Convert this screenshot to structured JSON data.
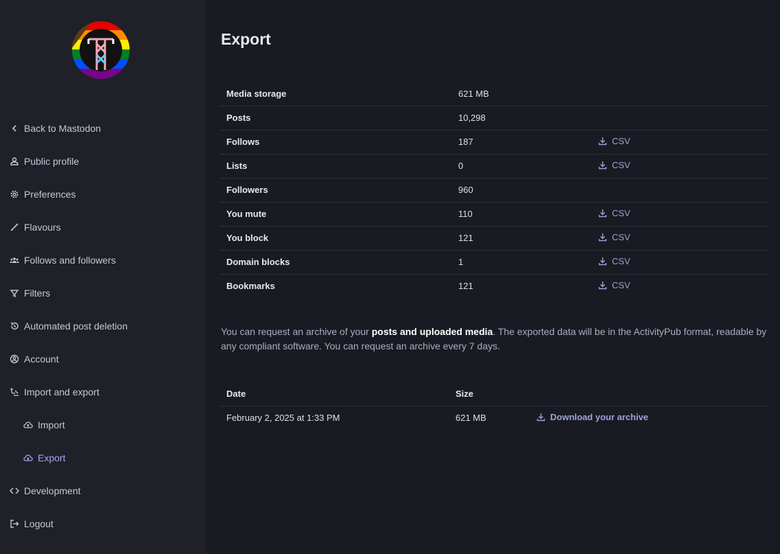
{
  "sidebar": {
    "nav": [
      {
        "label": "Back to Mastodon",
        "icon": "chevron-left-icon"
      },
      {
        "label": "Public profile",
        "icon": "person-icon"
      },
      {
        "label": "Preferences",
        "icon": "gear-icon"
      },
      {
        "label": "Flavours",
        "icon": "brush-icon"
      },
      {
        "label": "Follows and followers",
        "icon": "group-icon"
      },
      {
        "label": "Filters",
        "icon": "filter-icon"
      },
      {
        "label": "Automated post deletion",
        "icon": "history-icon"
      },
      {
        "label": "Account",
        "icon": "account-circle-icon"
      },
      {
        "label": "Import and export",
        "icon": "sync-alt-icon"
      },
      {
        "label": "Import",
        "icon": "cloud-upload-icon"
      },
      {
        "label": "Export",
        "icon": "cloud-download-icon"
      },
      {
        "label": "Development",
        "icon": "code-icon"
      },
      {
        "label": "Logout",
        "icon": "logout-icon"
      }
    ],
    "active_color": "#a8a3f5"
  },
  "main": {
    "title": "Export",
    "stats": [
      {
        "label": "Media storage",
        "value": "621 MB",
        "csv": ""
      },
      {
        "label": "Posts",
        "value": "10,298",
        "csv": ""
      },
      {
        "label": "Follows",
        "value": "187",
        "csv": "CSV"
      },
      {
        "label": "Lists",
        "value": "0",
        "csv": "CSV"
      },
      {
        "label": "Followers",
        "value": "960",
        "csv": ""
      },
      {
        "label": "You mute",
        "value": "110",
        "csv": "CSV"
      },
      {
        "label": "You block",
        "value": "121",
        "csv": "CSV"
      },
      {
        "label": "Domain blocks",
        "value": "1",
        "csv": "CSV"
      },
      {
        "label": "Bookmarks",
        "value": "121",
        "csv": "CSV"
      }
    ],
    "archive_text": {
      "before": "You can request an archive of your ",
      "strong": "posts and uploaded media",
      "after": ". The exported data will be in the ActivityPub format, readable by any compliant software. You can request an archive every 7 days."
    },
    "archives": {
      "headers": {
        "date": "Date",
        "size": "Size"
      },
      "rows": [
        {
          "date": "February 2, 2025 at 1:33 PM",
          "size": "621 MB",
          "action": "Download your archive"
        }
      ]
    }
  }
}
